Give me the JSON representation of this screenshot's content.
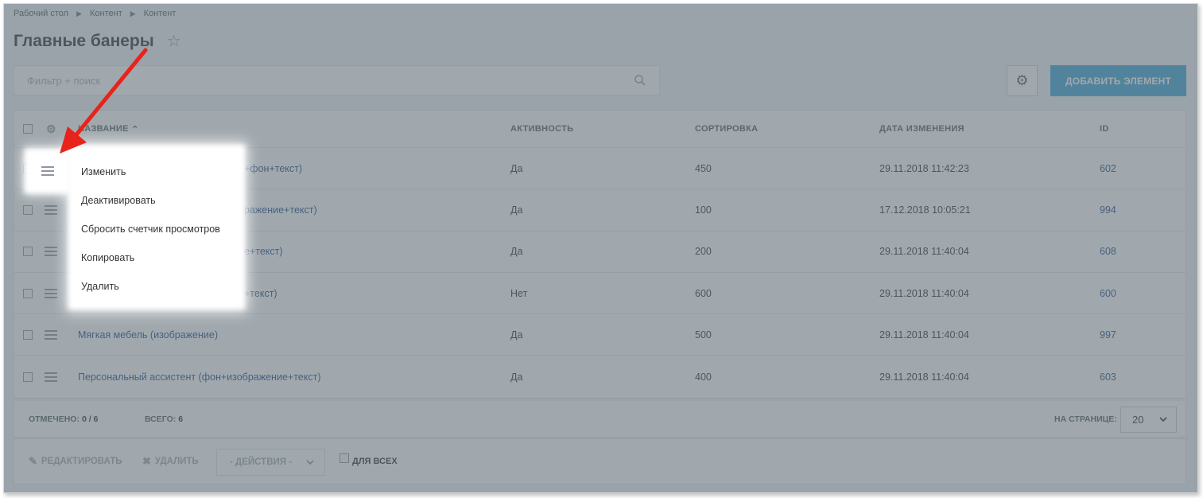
{
  "breadcrumb": [
    "Рабочий стол",
    "Контент",
    "Контент"
  ],
  "title": "Главные банеры",
  "search": {
    "placeholder": "Фильтр + поиск"
  },
  "add_button": "ДОБАВИТЬ ЭЛЕМЕНТ",
  "table": {
    "headers": {
      "name": "НАЗВАНИЕ",
      "activity": "АКТИВНОСТЬ",
      "sort": "СОРТИРОВКА",
      "date": "ДАТА ИЗМЕНЕНИЯ",
      "id": "ID"
    },
    "rows": [
      {
        "name": "+фон+текст)",
        "activity": "Да",
        "sort": "450",
        "date": "29.11.2018 11:42:23",
        "id": "602"
      },
      {
        "name": "ражение+текст)",
        "activity": "Да",
        "sort": "100",
        "date": "17.12.2018 10:05:21",
        "id": "994"
      },
      {
        "name": "е+текст)",
        "activity": "Да",
        "sort": "200",
        "date": "29.11.2018 11:40:04",
        "id": "608"
      },
      {
        "name": "+текст)",
        "activity": "Нет",
        "sort": "600",
        "date": "29.11.2018 11:40:04",
        "id": "600"
      },
      {
        "name": "Мягкая мебель (изображение)",
        "activity": "Да",
        "sort": "500",
        "date": "29.11.2018 11:40:04",
        "id": "997"
      },
      {
        "name": "Персональный ассистент (фон+изображение+текст)",
        "activity": "Да",
        "sort": "400",
        "date": "29.11.2018 11:40:04",
        "id": "603"
      }
    ]
  },
  "footer": {
    "checked_label": "ОТМЕЧЕНО:",
    "checked_value": "0 / 6",
    "total_label": "ВСЕГО:",
    "total_value": "6",
    "per_page_label": "НА СТРАНИЦЕ:",
    "per_page_value": "20"
  },
  "actions": {
    "edit": "РЕДАКТИРОВАТЬ",
    "delete": "УДАЛИТЬ",
    "select": "- ДЕЙСТВИЯ -",
    "for_all": "ДЛЯ ВСЕХ"
  },
  "context_menu": [
    "Изменить",
    "Деактивировать",
    "Сбросить счетчик просмотров",
    "Копировать",
    "Удалить"
  ],
  "colors": {
    "accent": "#3ea4d6",
    "link": "#254d87",
    "annotation_arrow": "#e8231b"
  }
}
